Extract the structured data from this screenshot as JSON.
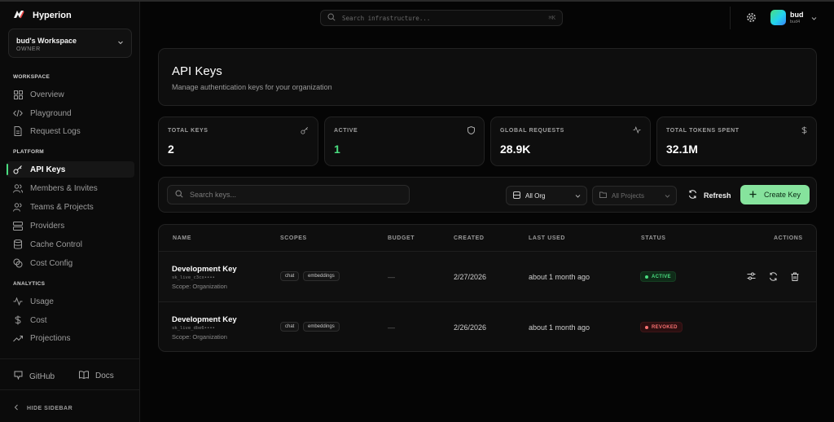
{
  "app": {
    "name": "Hyperion"
  },
  "workspace": {
    "name": "bud's Workspace",
    "role": "OWNER"
  },
  "sidebar": {
    "sections": [
      {
        "label": "WORKSPACE",
        "items": [
          {
            "label": "Overview",
            "icon": "grid-icon"
          },
          {
            "label": "Playground",
            "icon": "code-icon"
          },
          {
            "label": "Request Logs",
            "icon": "file-icon"
          }
        ]
      },
      {
        "label": "PLATFORM",
        "items": [
          {
            "label": "API Keys",
            "icon": "key-icon",
            "active": true
          },
          {
            "label": "Members & Invites",
            "icon": "users-icon"
          },
          {
            "label": "Teams & Projects",
            "icon": "team-icon"
          },
          {
            "label": "Providers",
            "icon": "server-icon"
          },
          {
            "label": "Cache Control",
            "icon": "database-icon"
          },
          {
            "label": "Cost Config",
            "icon": "coins-icon"
          }
        ]
      },
      {
        "label": "ANALYTICS",
        "items": [
          {
            "label": "Usage",
            "icon": "activity-icon"
          },
          {
            "label": "Cost",
            "icon": "dollar-icon"
          },
          {
            "label": "Projections",
            "icon": "trend-icon"
          }
        ]
      }
    ],
    "footer": {
      "github": "GitHub",
      "docs": "Docs",
      "hide": "HIDE SIDEBAR"
    }
  },
  "header": {
    "search_placeholder": "Search infrastructure...",
    "shortcut": "⌘K",
    "user": {
      "name": "bud",
      "sub": "bud4"
    }
  },
  "page": {
    "title": "API Keys",
    "subtitle": "Manage authentication keys for your organization"
  },
  "stats": [
    {
      "label": "TOTAL KEYS",
      "value": "2",
      "icon": "key-icon",
      "color": "#ffffff"
    },
    {
      "label": "ACTIVE",
      "value": "1",
      "icon": "shield-icon",
      "color": "#4ade80"
    },
    {
      "label": "GLOBAL REQUESTS",
      "value": "28.9K",
      "icon": "activity-icon",
      "color": "#ffffff"
    },
    {
      "label": "TOTAL TOKENS SPENT",
      "value": "32.1M",
      "icon": "dollar-icon",
      "color": "#ffffff"
    }
  ],
  "toolbar": {
    "search_placeholder": "Search keys...",
    "org_select": "All Org",
    "project_select": "All Projects",
    "refresh": "Refresh",
    "create": "Create Key"
  },
  "table": {
    "columns": [
      "NAME",
      "SCOPES",
      "BUDGET",
      "CREATED",
      "LAST USED",
      "STATUS",
      "ACTIONS"
    ],
    "rows": [
      {
        "name": "Development Key",
        "key": "sk_live_c3cx••••",
        "scope": "Scope: Organization",
        "scopes": [
          "chat",
          "embeddings"
        ],
        "budget": "—",
        "created": "2/27/2026",
        "last_used": "about 1 month ago",
        "status": "ACTIVE"
      },
      {
        "name": "Development Key",
        "key": "sk_live_dbe6••••",
        "scope": "Scope: Organization",
        "scopes": [
          "chat",
          "embeddings"
        ],
        "budget": "—",
        "created": "2/26/2026",
        "last_used": "about 1 month ago",
        "status": "REVOKED"
      }
    ]
  },
  "colors": {
    "accent": "#4ade80",
    "danger": "#f87171",
    "create_button": "#86e39d"
  }
}
